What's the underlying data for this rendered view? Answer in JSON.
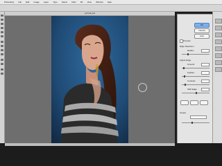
{
  "menubar": {
    "items": [
      "Photoshop",
      "File",
      "Edit",
      "Image",
      "Layer",
      "Type",
      "Select",
      "Filter",
      "3D",
      "View",
      "Window",
      "Help"
    ]
  },
  "document": {
    "title": "portrait.psd"
  },
  "dialog": {
    "ok_label": "OK",
    "cancel_label": "Cancel",
    "auto_label": "Auto",
    "preview_label": "Preview",
    "sections": [
      "Edge Detection",
      "Adjust Edge",
      "Output"
    ],
    "fields": [
      "Radius",
      "Smooth",
      "Feather",
      "Contrast",
      "Shift Edge"
    ]
  },
  "colors": {
    "background_blue": "#1f4a74",
    "hair": "#4a2418",
    "skin": "#d8a48c",
    "top_stripe_dark": "#2a2a2a",
    "top_stripe_light": "#a9a9a9"
  }
}
